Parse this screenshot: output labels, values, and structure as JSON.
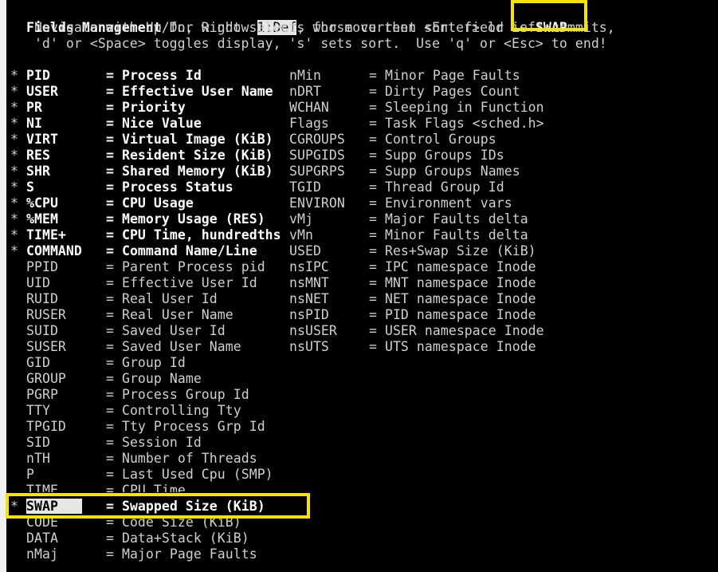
{
  "header": {
    "title_bold": "Fields Management",
    "for_window_text": " for window ",
    "window_name": "1:Def",
    "sort_text": ", whose current sort field is ",
    "sort_field": "SWAP",
    "line2": "   Navigate with Up/Dn, Right selects for move then <Enter> or Left commits,",
    "line3": "   'd' or <Space> toggles display, 's' sets sort.  Use 'q' or <Esc> to end!"
  },
  "left_fields": [
    {
      "star": "*",
      "name": "PID",
      "desc": "= Process Id",
      "on": true
    },
    {
      "star": "*",
      "name": "USER",
      "desc": "= Effective User Name",
      "on": true
    },
    {
      "star": "*",
      "name": "PR",
      "desc": "= Priority",
      "on": true
    },
    {
      "star": "*",
      "name": "NI",
      "desc": "= Nice Value",
      "on": true
    },
    {
      "star": "*",
      "name": "VIRT",
      "desc": "= Virtual Image (KiB)",
      "on": true
    },
    {
      "star": "*",
      "name": "RES",
      "desc": "= Resident Size (KiB)",
      "on": true
    },
    {
      "star": "*",
      "name": "SHR",
      "desc": "= Shared Memory (KiB)",
      "on": true
    },
    {
      "star": "*",
      "name": "S",
      "desc": "= Process Status",
      "on": true
    },
    {
      "star": "*",
      "name": "%CPU",
      "desc": "= CPU Usage",
      "on": true
    },
    {
      "star": "*",
      "name": "%MEM",
      "desc": "= Memory Usage (RES)",
      "on": true
    },
    {
      "star": "*",
      "name": "TIME+",
      "desc": "= CPU Time, hundredths",
      "on": true
    },
    {
      "star": "*",
      "name": "COMMAND",
      "desc": "= Command Name/Line",
      "on": true
    },
    {
      "star": "",
      "name": "PPID",
      "desc": "= Parent Process pid",
      "on": false
    },
    {
      "star": "",
      "name": "UID",
      "desc": "= Effective User Id",
      "on": false
    },
    {
      "star": "",
      "name": "RUID",
      "desc": "= Real User Id",
      "on": false
    },
    {
      "star": "",
      "name": "RUSER",
      "desc": "= Real User Name",
      "on": false
    },
    {
      "star": "",
      "name": "SUID",
      "desc": "= Saved User Id",
      "on": false
    },
    {
      "star": "",
      "name": "SUSER",
      "desc": "= Saved User Name",
      "on": false
    },
    {
      "star": "",
      "name": "GID",
      "desc": "= Group Id",
      "on": false
    },
    {
      "star": "",
      "name": "GROUP",
      "desc": "= Group Name",
      "on": false
    },
    {
      "star": "",
      "name": "PGRP",
      "desc": "= Process Group Id",
      "on": false
    },
    {
      "star": "",
      "name": "TTY",
      "desc": "= Controlling Tty",
      "on": false
    },
    {
      "star": "",
      "name": "TPGID",
      "desc": "= Tty Process Grp Id",
      "on": false
    },
    {
      "star": "",
      "name": "SID",
      "desc": "= Session Id",
      "on": false
    },
    {
      "star": "",
      "name": "nTH",
      "desc": "= Number of Threads",
      "on": false
    },
    {
      "star": "",
      "name": "P",
      "desc": "= Last Used Cpu (SMP)",
      "on": false
    },
    {
      "star": "",
      "name": "TIME",
      "desc": "= CPU Time",
      "on": false
    },
    {
      "star": "*",
      "name": "SWAP",
      "desc": "= Swapped Size (KiB)",
      "on": true
    },
    {
      "star": "",
      "name": "CODE",
      "desc": "= Code Size (KiB)",
      "on": false
    },
    {
      "star": "",
      "name": "DATA",
      "desc": "= Data+Stack (KiB)",
      "on": false
    },
    {
      "star": "",
      "name": "nMaj",
      "desc": "= Major Page Faults",
      "on": false
    }
  ],
  "right_fields": [
    {
      "name": "nMin",
      "desc": "= Minor Page Faults"
    },
    {
      "name": "nDRT",
      "desc": "= Dirty Pages Count"
    },
    {
      "name": "WCHAN",
      "desc": "= Sleeping in Function"
    },
    {
      "name": "Flags",
      "desc": "= Task Flags <sched.h>"
    },
    {
      "name": "CGROUPS",
      "desc": "= Control Groups"
    },
    {
      "name": "SUPGIDS",
      "desc": "= Supp Groups IDs"
    },
    {
      "name": "SUPGRPS",
      "desc": "= Supp Groups Names"
    },
    {
      "name": "TGID",
      "desc": "= Thread Group Id"
    },
    {
      "name": "ENVIRON",
      "desc": "= Environment vars"
    },
    {
      "name": "vMj",
      "desc": "= Major Faults delta"
    },
    {
      "name": "vMn",
      "desc": "= Minor Faults delta"
    },
    {
      "name": "USED",
      "desc": "= Res+Swap Size (KiB)"
    },
    {
      "name": "nsIPC",
      "desc": "= IPC namespace Inode"
    },
    {
      "name": "nsMNT",
      "desc": "= MNT namespace Inode"
    },
    {
      "name": "nsNET",
      "desc": "= NET namespace Inode"
    },
    {
      "name": "nsPID",
      "desc": "= PID namespace Inode"
    },
    {
      "name": "nsUSER",
      "desc": "= USER namespace Inode"
    },
    {
      "name": "nsUTS",
      "desc": "= UTS namespace Inode"
    }
  ],
  "colors": {
    "annotation_box": "#f5e400",
    "text": "#cfcfcf",
    "text_bold": "#ffffff",
    "background": "#000000",
    "highlight": "#e6e6e6"
  }
}
